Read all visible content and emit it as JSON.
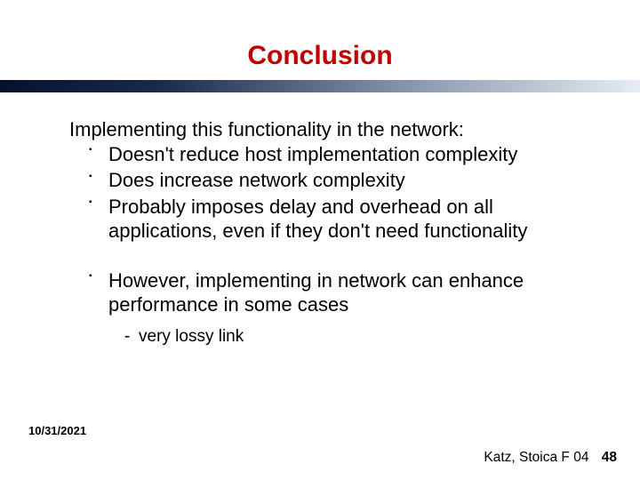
{
  "title": "Conclusion",
  "lead": "Implementing this functionality in the network:",
  "bullets": {
    "b0": "Doesn't reduce host implementation complexity",
    "b1": "Does increase network complexity",
    "b2": "Probably imposes delay and overhead on all applications, even if they don't need functionality",
    "b3": "However, implementing in network can enhance performance in some cases"
  },
  "sub": {
    "s0": "very lossy link"
  },
  "footer": {
    "date": "10/31/2021",
    "credit": "Katz, Stoica F 04",
    "page": "48"
  }
}
